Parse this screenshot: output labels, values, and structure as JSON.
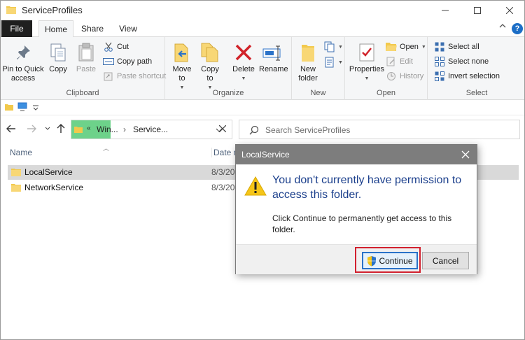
{
  "window": {
    "title": "ServiceProfiles"
  },
  "ribbon_tabs": [
    "File",
    "Home",
    "Share",
    "View"
  ],
  "ribbon": {
    "clipboard": {
      "pin": "Pin to Quick access",
      "copy": "Copy",
      "paste": "Paste",
      "cut": "Cut",
      "copy_path": "Copy path",
      "paste_shortcut": "Paste shortcut",
      "label": "Clipboard"
    },
    "organize": {
      "move_to": "Move to",
      "copy_to": "Copy to",
      "delete": "Delete",
      "rename": "Rename",
      "label": "Organize"
    },
    "new": {
      "new_folder": "New folder",
      "label": "New"
    },
    "open": {
      "properties": "Properties",
      "open": "Open",
      "edit": "Edit",
      "history": "History",
      "label": "Open"
    },
    "select": {
      "select_all": "Select all",
      "select_none": "Select none",
      "invert": "Invert selection",
      "label": "Select"
    }
  },
  "address": {
    "chevron": "«",
    "crumb1": "Win...",
    "crumb2": "Service...",
    "search_placeholder": "Search ServiceProfiles"
  },
  "columns": {
    "name": "Name",
    "date": "Date m"
  },
  "files": [
    {
      "name": "LocalService",
      "date": "8/3/20",
      "selected": true
    },
    {
      "name": "NetworkService",
      "date": "8/3/20",
      "selected": false
    }
  ],
  "dialog": {
    "title": "LocalService",
    "message": "You don't currently have permission to access this folder.",
    "detail": "Click Continue to permanently get access to this folder.",
    "continue_label": "Continue",
    "cancel_label": "Cancel"
  },
  "colors": {
    "accent": "#1c6ec6",
    "highlight_border": "#d2202e",
    "dialog_title_bg": "#7d7d7d",
    "address_highlight": "#6dd28a",
    "folder": "#f2c94c"
  }
}
